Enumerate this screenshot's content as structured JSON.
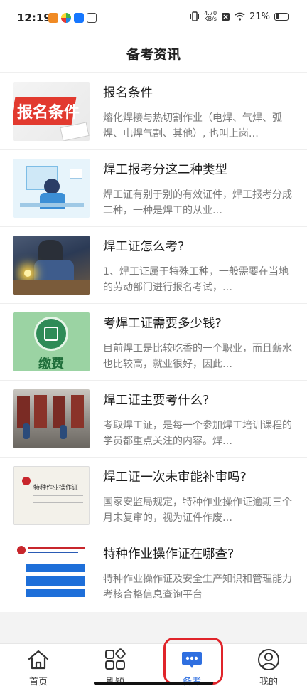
{
  "status": {
    "time": "12:19",
    "net_speed_value": "4.70",
    "net_speed_unit": "KB/s",
    "battery": "21%"
  },
  "header": {
    "title": "备考资讯"
  },
  "articles": [
    {
      "title": "报名条件",
      "desc": "熔化焊接与热切割作业（电焊、气焊、弧焊、电焊气割、其他）, 也叫上岗…",
      "thumb_text": "报名条件"
    },
    {
      "title": "焊工报考分这二种类型",
      "desc": "焊工证有别于别的有效证件，焊工报考分成二种，一种是焊工的从业…"
    },
    {
      "title": "焊工证怎么考?",
      "desc": "1、焊工证属于特殊工种，一般需要在当地的劳动部门进行报名考试，…"
    },
    {
      "title": "考焊工证需要多少钱?",
      "desc": "目前焊工是比较吃香的一个职业，而且薪水也比较高，就业很好，因此…",
      "thumb_text": "缴费"
    },
    {
      "title": "焊工证主要考什么?",
      "desc": "考取焊工证，是每一个参加焊工培训课程的学员都重点关注的内容。焊…"
    },
    {
      "title": "焊工证一次未审能补审吗?",
      "desc": "国家安监局规定，特种作业操作证逾期三个月未复审的，视为证件作废…",
      "thumb_text": "特种作业操作证"
    },
    {
      "title": "特种作业操作证在哪查?",
      "desc": "特种作业操作证及安全生产知识和管理能力考核合格信息查询平台"
    }
  ],
  "tabs": [
    {
      "label": "首页",
      "icon": "home-icon"
    },
    {
      "label": "刷题",
      "icon": "grid-icon"
    },
    {
      "label": "备考",
      "icon": "chat-bubble-icon"
    },
    {
      "label": "我的",
      "icon": "user-icon"
    }
  ],
  "active_tab": "备考",
  "colors": {
    "accent": "#2f6fe0",
    "highlight": "#e0242a"
  }
}
